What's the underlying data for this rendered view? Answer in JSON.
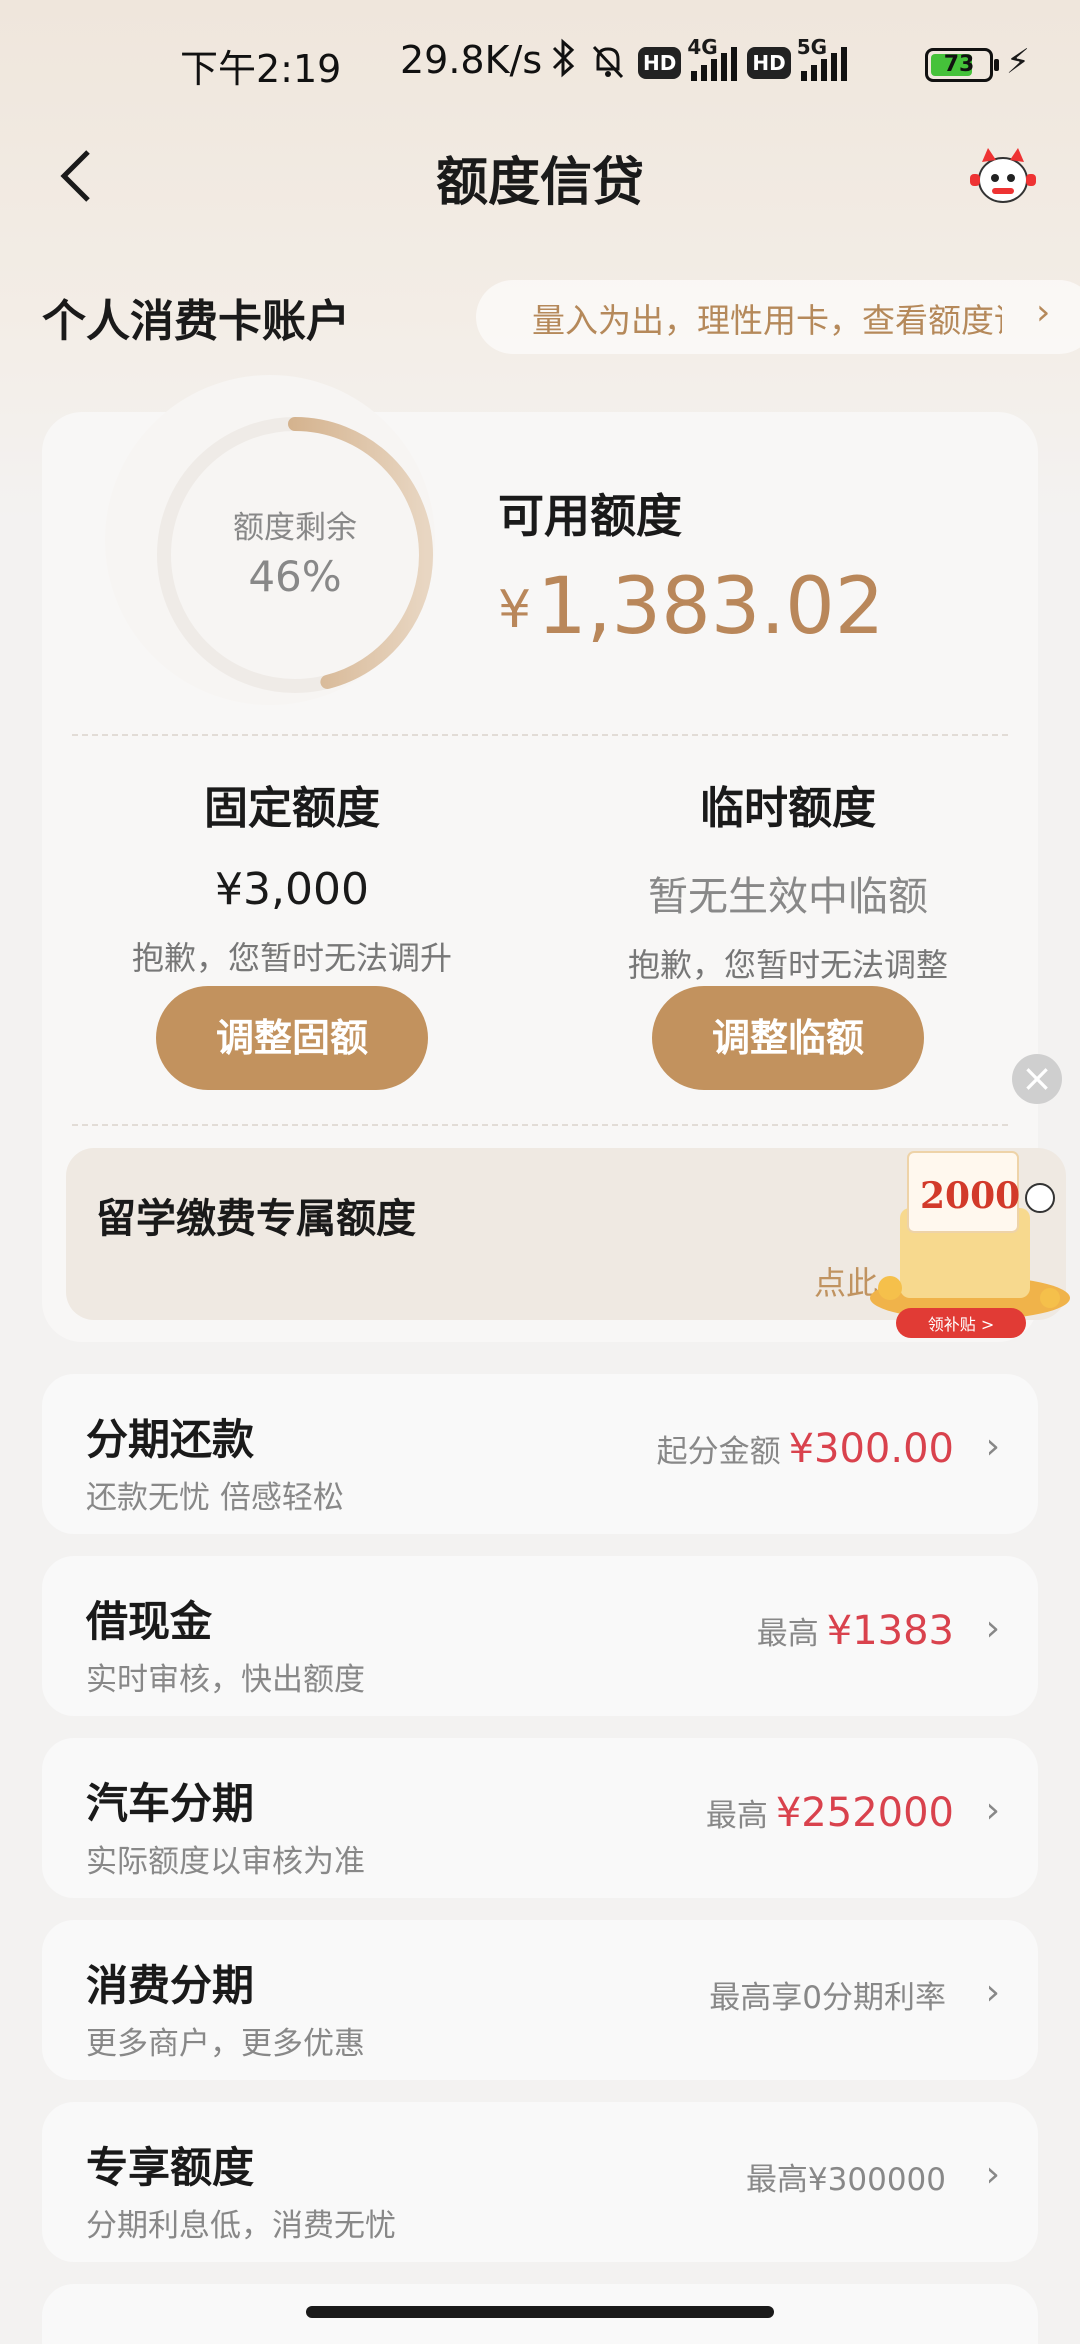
{
  "status": {
    "time": "下午2:19",
    "net_speed": "29.8K/s",
    "hd": "HD",
    "sig1": "4G",
    "sig2": "5G",
    "battery": "73",
    "battery_level": 0.73
  },
  "nav": {
    "title": "额度信贷"
  },
  "section": {
    "title": "个人消费卡账户",
    "promo": "量入为出，理性用卡，查看额度详情"
  },
  "summary": {
    "ring_label": "额度剩余",
    "ring_pct": "46%",
    "ring_fraction": 0.46,
    "avail_label": "可用额度",
    "currency": "¥",
    "avail_amount": "1,383.02"
  },
  "fixed": {
    "title": "固定额度",
    "value": "¥3,000",
    "note": "抱歉，您暂时无法调升",
    "button": "调整固额"
  },
  "temp": {
    "title": "临时额度",
    "value": "暂无生效中临额",
    "note": "抱歉，您暂时无法调整",
    "button": "调整临额"
  },
  "study": {
    "title": "留学缴费专属额度",
    "hint": "点此",
    "badge_amount": "2000",
    "badge_btn": "领补贴 >"
  },
  "items": [
    {
      "title": "分期还款",
      "sub": "还款无忧 倍感轻松",
      "right_label": "起分金额",
      "right_amount": "¥300.00"
    },
    {
      "title": "借现金",
      "sub": "实时审核，快出额度",
      "right_label": "最高",
      "right_amount": "¥1383"
    },
    {
      "title": "汽车分期",
      "sub": "实际额度以审核为准",
      "right_label": "最高",
      "right_amount": "¥252000"
    },
    {
      "title": "消费分期",
      "sub": "更多商户，更多优惠",
      "right_label": "最高享0分期利率",
      "right_amount": ""
    },
    {
      "title": "专享额度",
      "sub": "分期利息低，消费无忧",
      "right_label": "最高¥300000",
      "right_amount": ""
    }
  ]
}
